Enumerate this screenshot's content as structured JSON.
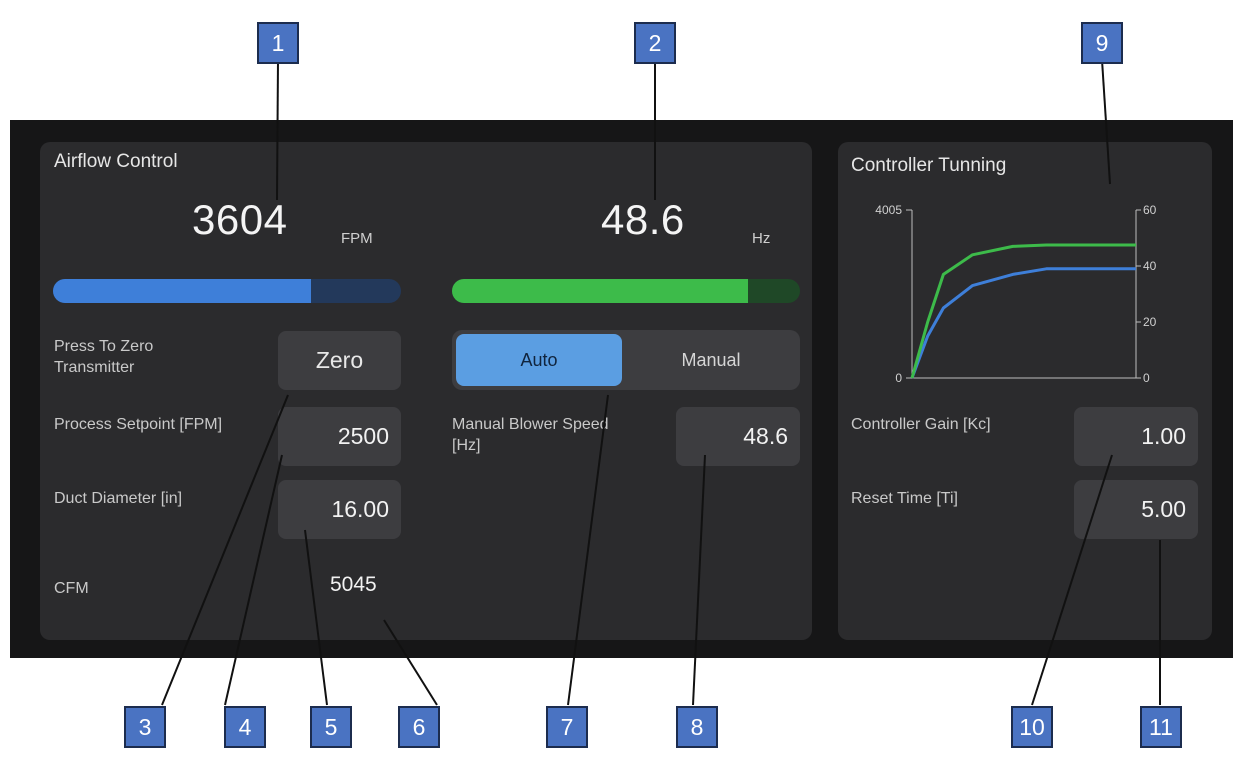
{
  "airflow": {
    "title": "Airflow Control",
    "fpm_value": "3604",
    "fpm_unit": "FPM",
    "fpm_fraction": 0.74,
    "hz_value": "48.6",
    "hz_unit": "Hz",
    "hz_fraction": 0.85,
    "zero_label": "Press To Zero Transmitter",
    "zero_button": "Zero",
    "setpoint_label": "Process Setpoint [FPM]",
    "setpoint_value": "2500",
    "duct_label": "Duct Diameter [in]",
    "duct_value": "16.00",
    "cfm_label": "CFM",
    "cfm_value": "5045",
    "mode_auto": "Auto",
    "mode_manual": "Manual",
    "mode_selected": "Auto",
    "manual_speed_label": "Manual Blower Speed [Hz]",
    "manual_speed_value": "48.6"
  },
  "tuning": {
    "title": "Controller Tunning",
    "gain_label": "Controller Gain [Kc]",
    "gain_value": "1.00",
    "reset_label": "Reset Time [Ti]",
    "reset_value": "5.00"
  },
  "chart_data": {
    "type": "line",
    "left_axis": {
      "min": 0,
      "max": 4005,
      "ticks": [
        "4005",
        "0"
      ]
    },
    "right_axis": {
      "min": 0,
      "max": 60,
      "ticks": [
        "60",
        "40",
        "20",
        "0"
      ]
    },
    "series": [
      {
        "color": "#3e7fd9",
        "axis": "right",
        "x": [
          0,
          0.07,
          0.14,
          0.27,
          0.45,
          0.6,
          1.0
        ],
        "y": [
          0,
          15,
          25,
          33,
          37,
          39,
          39
        ]
      },
      {
        "color": "#3dbb4a",
        "axis": "right",
        "x": [
          0,
          0.07,
          0.14,
          0.27,
          0.45,
          0.6,
          1.0
        ],
        "y": [
          0,
          20,
          37,
          44,
          47,
          47.5,
          47.5
        ]
      }
    ],
    "grid": false
  },
  "callouts": [
    "1",
    "2",
    "3",
    "4",
    "5",
    "6",
    "7",
    "8",
    "9",
    "10",
    "11"
  ],
  "colors": {
    "accent_blue": "#3e7fd9",
    "accent_green": "#3dbb4a",
    "panel": "#2b2b2d",
    "background": "#161617",
    "callout": "#4a73c2"
  }
}
